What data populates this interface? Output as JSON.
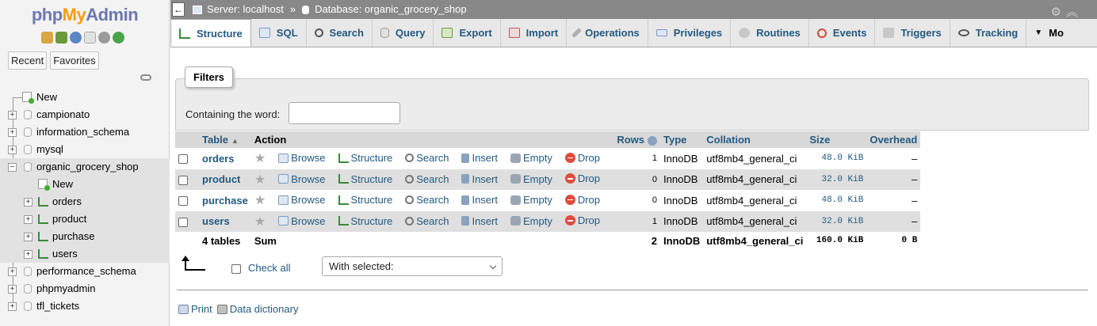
{
  "nav": {
    "logo": {
      "php": "php",
      "my": "My",
      "admin": "Admin"
    },
    "buttons": {
      "recent": "Recent",
      "favorites": "Favorites"
    },
    "tree": {
      "new": "New",
      "databases": [
        "campionato",
        "information_schema",
        "mysql",
        "organic_grocery_shop",
        "performance_schema",
        "phpmyadmin",
        "tfl_tickets"
      ],
      "selected_db": {
        "new": "New",
        "tables": [
          "orders",
          "product",
          "purchase",
          "users"
        ]
      }
    }
  },
  "breadcrumb": {
    "server": "Server: localhost",
    "separator": "»",
    "database": "Database: organic_grocery_shop"
  },
  "tabs": [
    "Structure",
    "SQL",
    "Search",
    "Query",
    "Export",
    "Import",
    "Operations",
    "Privileges",
    "Routines",
    "Events",
    "Triggers",
    "Tracking",
    "Mo"
  ],
  "filters": {
    "legend": "Filters",
    "label": "Containing the word:",
    "value": ""
  },
  "table": {
    "headers": {
      "table": "Table",
      "action": "Action",
      "rows": "Rows",
      "type": "Type",
      "collation": "Collation",
      "size": "Size",
      "overhead": "Overhead"
    },
    "actions": {
      "browse": "Browse",
      "structure": "Structure",
      "search": "Search",
      "insert": "Insert",
      "empty": "Empty",
      "drop": "Drop"
    },
    "rows": [
      {
        "name": "orders",
        "rows": "1",
        "type": "InnoDB",
        "collation": "utf8mb4_general_ci",
        "size": "48.0 KiB",
        "overhead": "–"
      },
      {
        "name": "product",
        "rows": "0",
        "type": "InnoDB",
        "collation": "utf8mb4_general_ci",
        "size": "32.0 KiB",
        "overhead": "–"
      },
      {
        "name": "purchase",
        "rows": "0",
        "type": "InnoDB",
        "collation": "utf8mb4_general_ci",
        "size": "48.0 KiB",
        "overhead": "–"
      },
      {
        "name": "users",
        "rows": "1",
        "type": "InnoDB",
        "collation": "utf8mb4_general_ci",
        "size": "32.0 KiB",
        "overhead": "–"
      }
    ],
    "footer": {
      "tables": "4 tables",
      "sum": "Sum",
      "rows": "2",
      "type": "InnoDB",
      "collation": "utf8mb4_general_ci",
      "size": "160.0 KiB",
      "overhead": "0 B"
    }
  },
  "bottom": {
    "check_all": "Check all",
    "with_selected": "With selected:",
    "print": "Print",
    "data_dictionary": "Data dictionary"
  },
  "colors": {
    "link": "#235a81",
    "topbar": "#888888",
    "drop": "#e04b3c"
  }
}
